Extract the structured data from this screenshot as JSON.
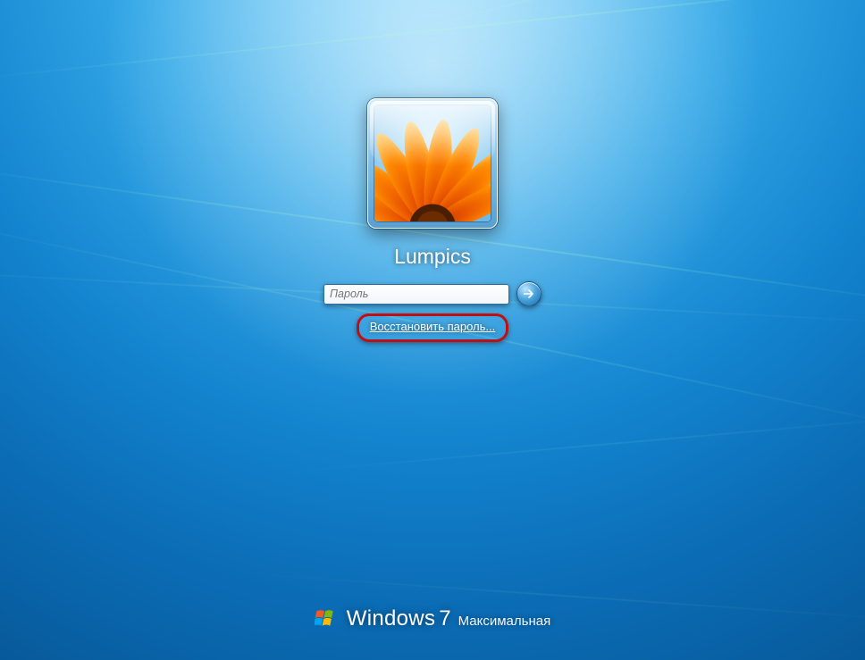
{
  "user": {
    "name": "Lumpics",
    "avatar_desc": "orange-flower-icon"
  },
  "password": {
    "placeholder": "Пароль"
  },
  "links": {
    "reset_password": "Восстановить пароль..."
  },
  "branding": {
    "product": "Windows",
    "version": "7",
    "edition": "Максимальная"
  },
  "colors": {
    "highlight_ring": "#c10e12",
    "bg_top": "#8fdcff",
    "bg_bottom": "#075a9a"
  }
}
